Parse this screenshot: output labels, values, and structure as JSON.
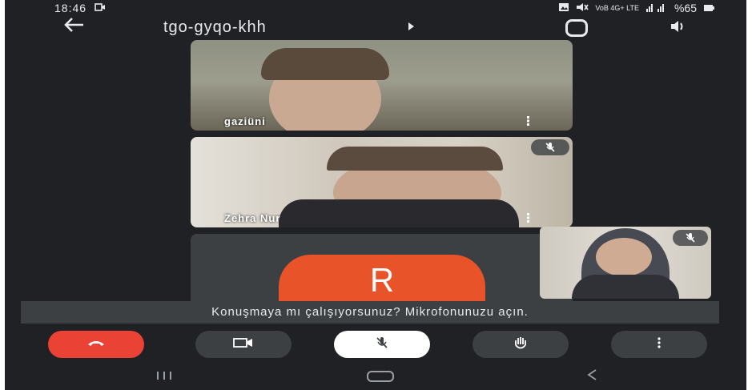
{
  "status_bar": {
    "time": "18:46",
    "network_small": "VoB 4G+ LTE",
    "battery": "%65"
  },
  "top_bar": {
    "meeting_code": "tgo-gyqo-khh"
  },
  "participants": [
    {
      "name": "gaziüni"
    },
    {
      "name": "Zehra Nur"
    },
    {
      "avatar_letter": "R"
    }
  ],
  "banner": {
    "text": "Konuşmaya mı çalışıyorsunuz? Mikrofonunuzu açın."
  },
  "colors": {
    "background": "#202124",
    "hangup": "#ea4335",
    "avatar": "#e8532a"
  }
}
